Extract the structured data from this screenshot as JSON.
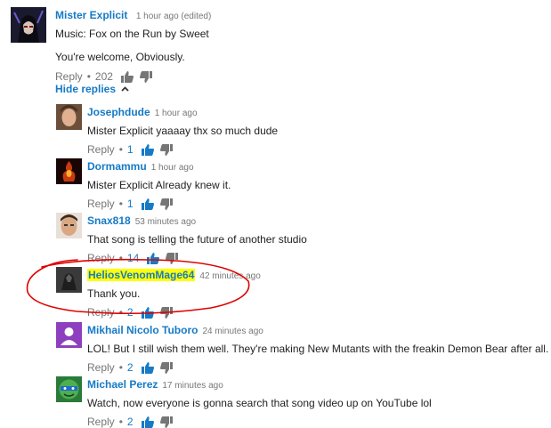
{
  "main_comment": {
    "author": "Mister Explicit",
    "time": "1 hour ago (edited)",
    "line1": "Music: Fox on the Run by Sweet",
    "line2": "You're welcome, Obviously.",
    "reply_label": "Reply",
    "sep": "•",
    "likes": "202"
  },
  "hide_replies_label": "Hide replies",
  "replies": [
    {
      "author": "Josephdude",
      "time": "1 hour ago",
      "text": "Mister Explicit yaaaay thx so much dude",
      "reply_label": "Reply",
      "sep": "•",
      "likes": "1"
    },
    {
      "author": "Dormammu",
      "time": "1 hour ago",
      "text": "Mister Explicit Already knew it.",
      "reply_label": "Reply",
      "sep": "•",
      "likes": "1"
    },
    {
      "author": "Snax818",
      "time": "53 minutes ago",
      "text": "That song is telling the future of another studio",
      "reply_label": "Reply",
      "sep": "•",
      "likes": "14"
    },
    {
      "author": "HeliosVenomMage64",
      "time": "42 minutes ago",
      "text": "Thank you.",
      "reply_label": "Reply",
      "sep": "•",
      "likes": "2"
    },
    {
      "author": "Mikhail Nicolo Tuboro",
      "time": "24 minutes ago",
      "text": "LOL! But I still wish them well. They're making New Mutants with the freakin Demon Bear after all.",
      "reply_label": "Reply",
      "sep": "•",
      "likes": "2"
    },
    {
      "author": "Michael Perez",
      "time": "17 minutes ago",
      "text": "Watch, now everyone is gonna search that song video up on YouTube lol",
      "reply_label": "Reply",
      "sep": "•",
      "likes": "2"
    }
  ],
  "colors": {
    "link": "#167ac6",
    "highlight": "#ffff00",
    "annotation": "#e00000"
  }
}
